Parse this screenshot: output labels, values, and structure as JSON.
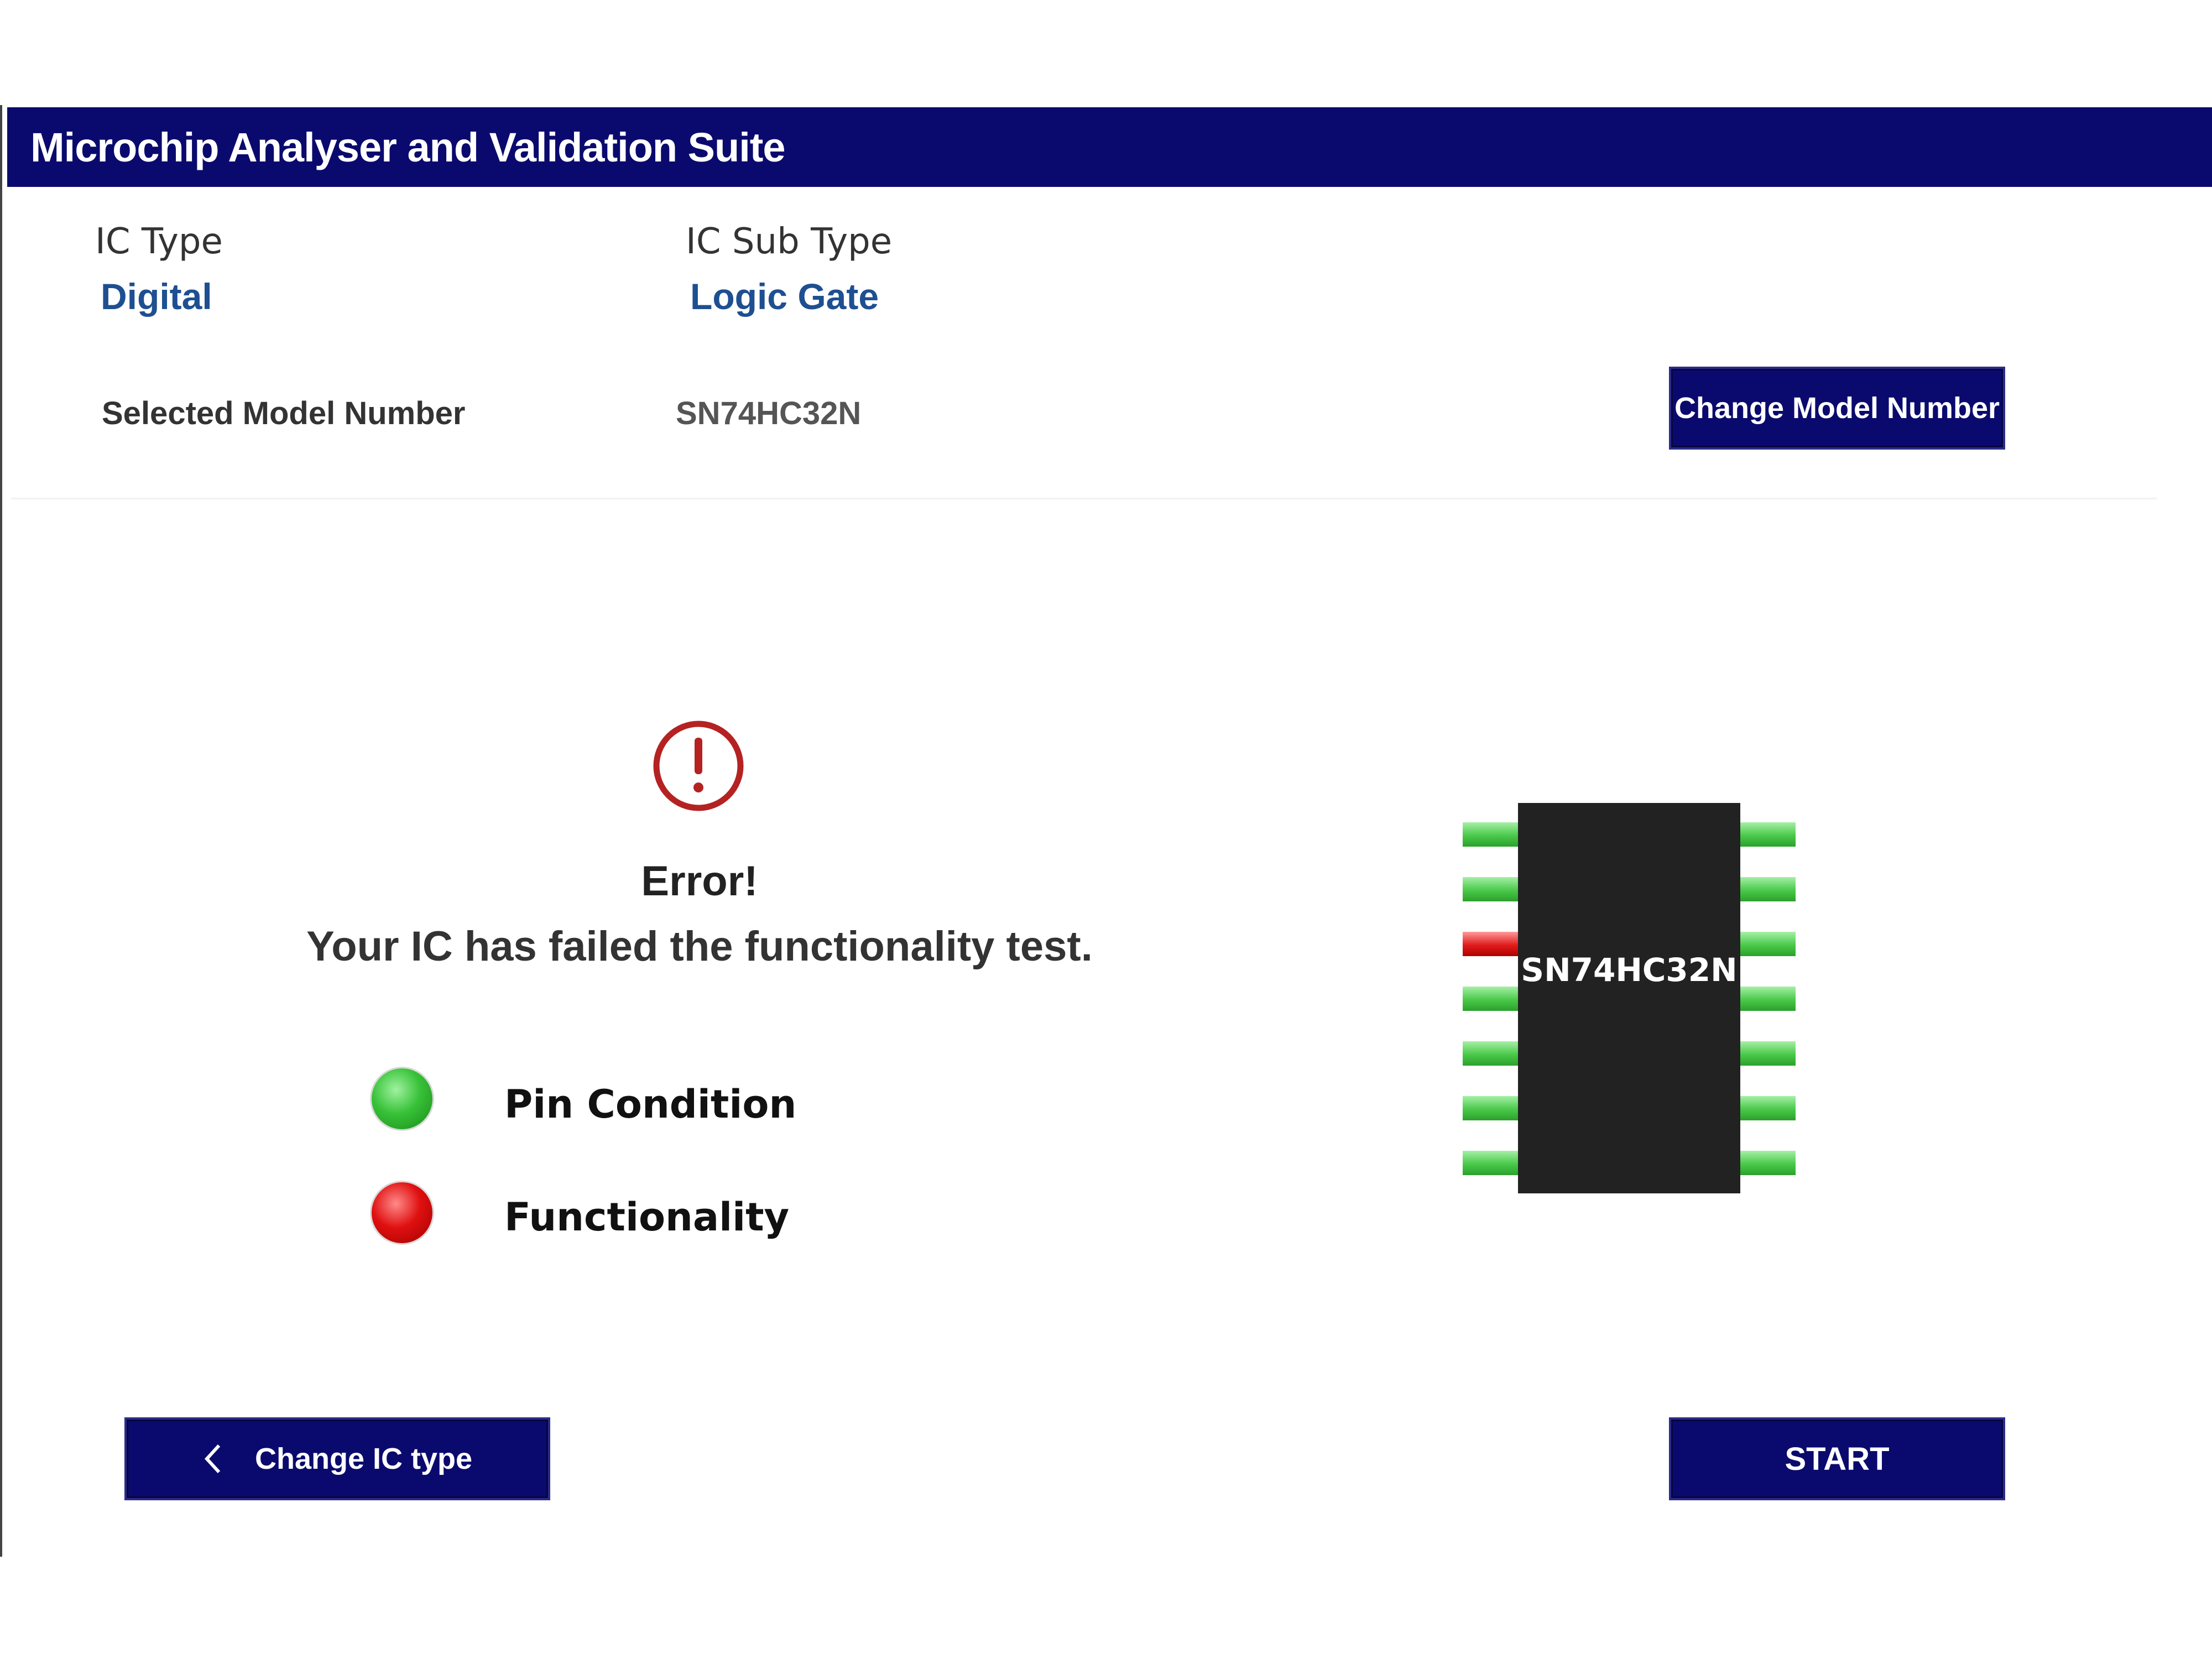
{
  "header": {
    "title": "Microchip Analyser and Validation Suite"
  },
  "ic_type": {
    "label": "IC Type",
    "value": "Digital"
  },
  "ic_sub_type": {
    "label": "IC Sub Type",
    "value": "Logic Gate"
  },
  "model": {
    "label": "Selected Model Number",
    "value": "SN74HC32N",
    "change_button": "Change Model Number"
  },
  "result": {
    "icon": "exclamation-circle-icon",
    "title": "Error!",
    "message": "Your IC has failed the functionality test."
  },
  "checks": [
    {
      "label": "Pin Condition",
      "status": "pass",
      "color": "#2ca02c"
    },
    {
      "label": "Functionality",
      "status": "fail",
      "color": "#e01010"
    }
  ],
  "chip": {
    "label": "SN74HC32N",
    "pin_count": 14,
    "failed_pins": [
      3
    ],
    "pin_ok_color": "#49c949",
    "pin_fail_color": "#e01b1b"
  },
  "footer": {
    "back_button": "Change IC type",
    "back_icon": "chevron-left-icon",
    "start_button": "START"
  },
  "colors": {
    "brand": "#0a0a6e",
    "value_text": "#1e4f91",
    "error_icon": "#b52222"
  }
}
